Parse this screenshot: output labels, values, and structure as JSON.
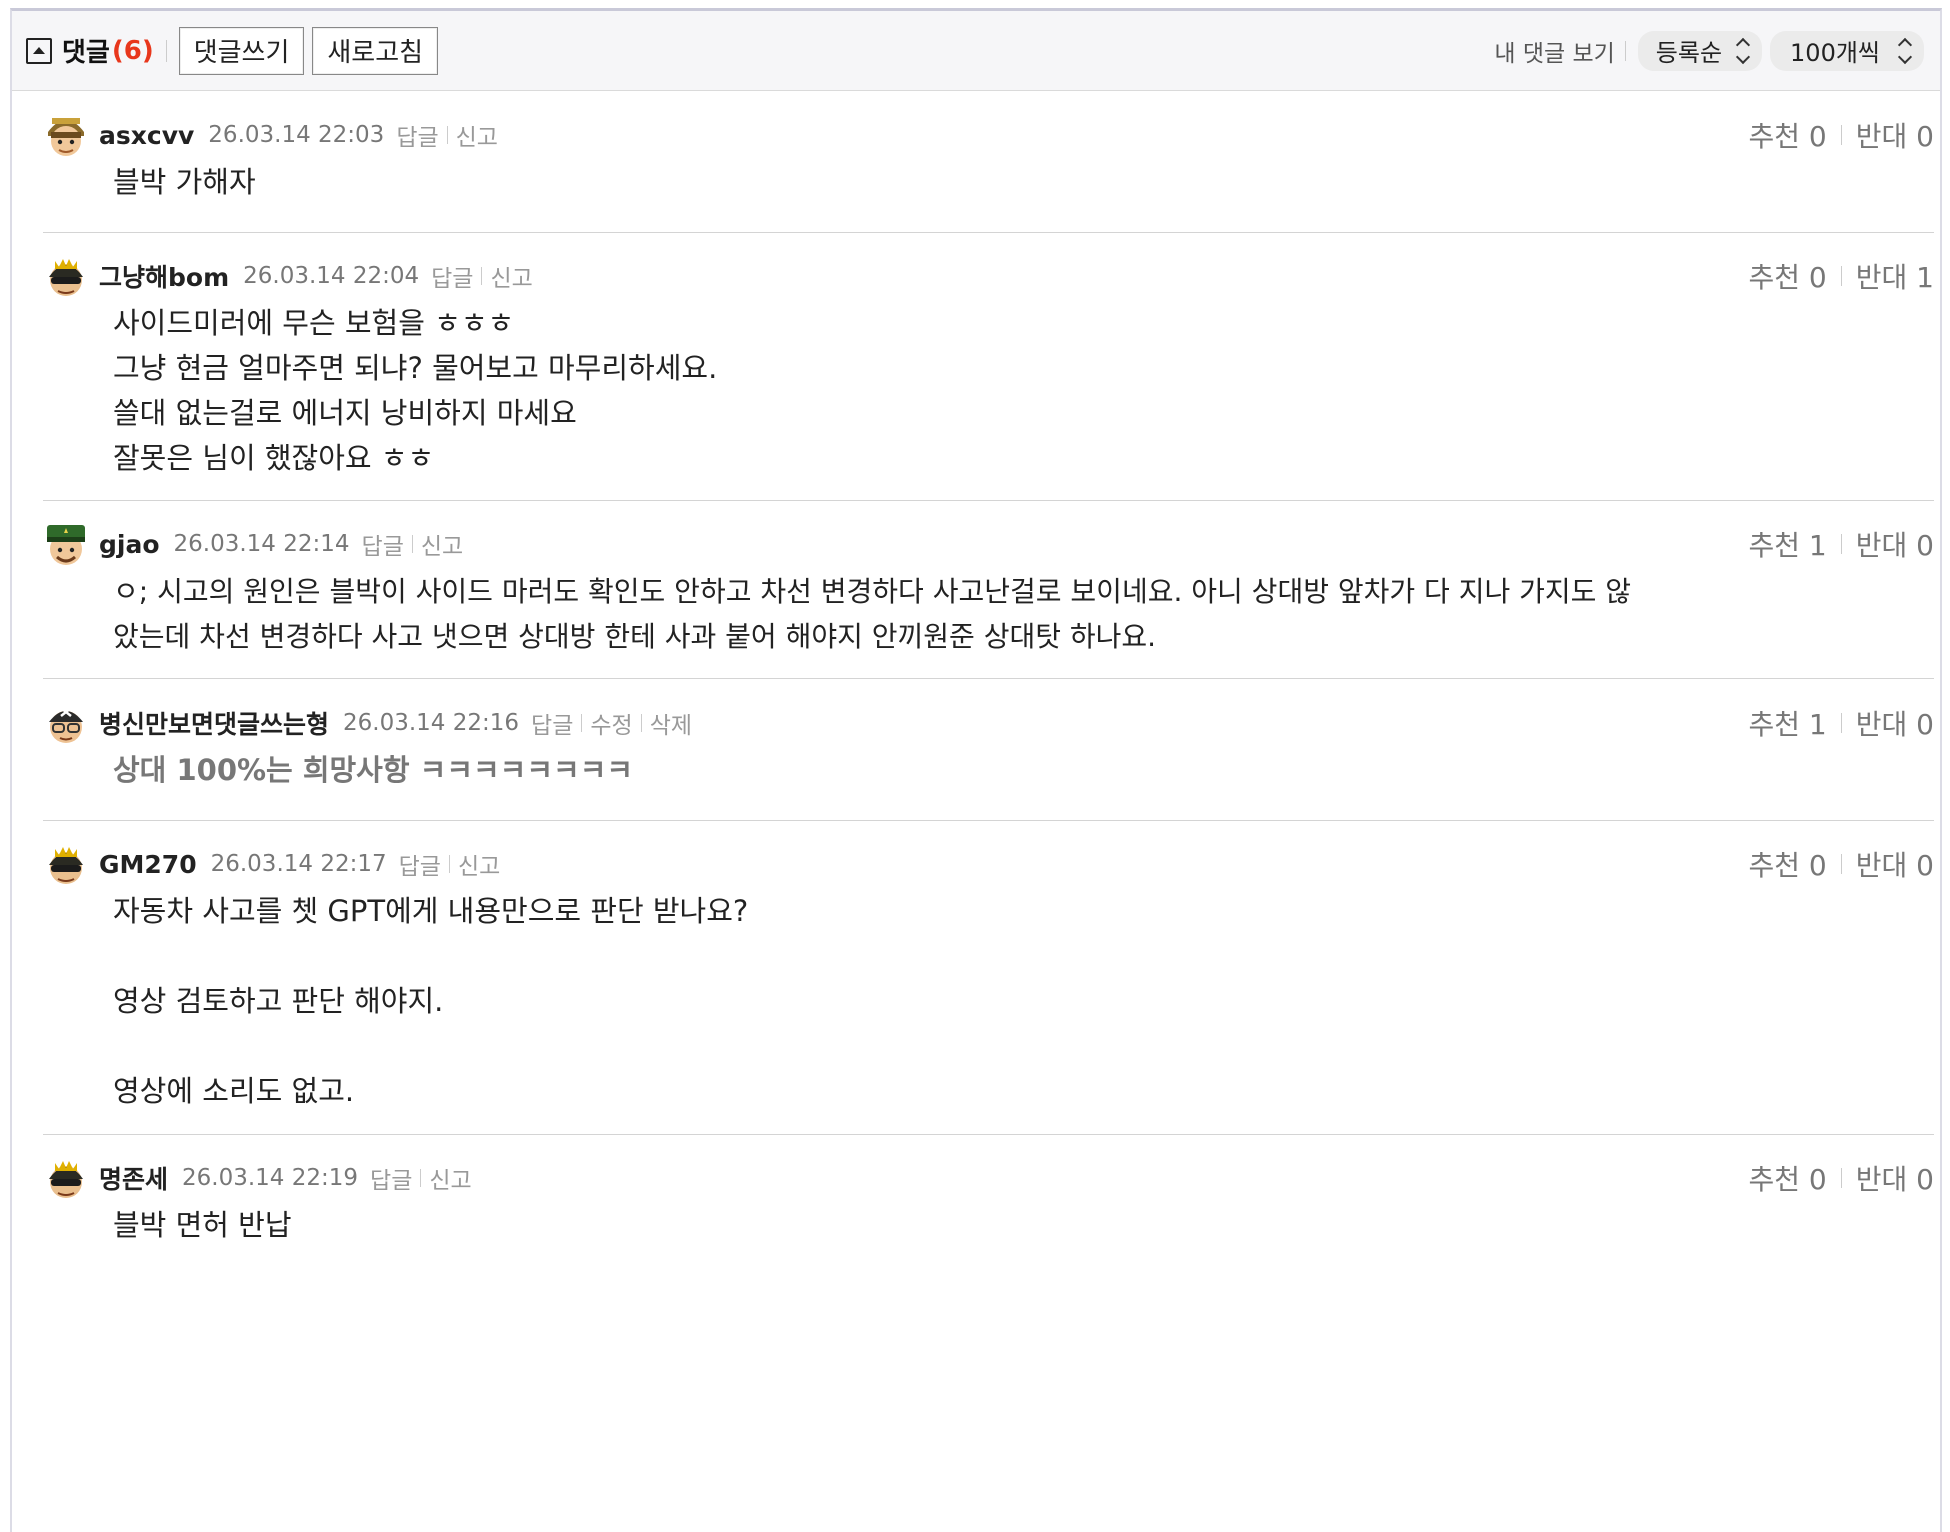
{
  "header": {
    "title": "댓글",
    "count": "(6)",
    "write_label": "댓글쓰기",
    "refresh_label": "새로고침",
    "my_comments_label": "내 댓글 보기",
    "sort_value": "등록순",
    "per_page_value": "100개씩"
  },
  "labels": {
    "recommend": "추천",
    "oppose": "반대"
  },
  "comments": [
    {
      "nick": "asxcvv",
      "date": "26.03.14 22:03",
      "actions": [
        "답글",
        "신고"
      ],
      "up": "0",
      "down": "0",
      "lines": [
        "블박 가해자"
      ]
    },
    {
      "nick": "그냥해bom",
      "date": "26.03.14 22:04",
      "actions": [
        "답글",
        "신고"
      ],
      "up": "0",
      "down": "1",
      "lines": [
        "사이드미러에 무슨 보험을 ㅎㅎㅎ",
        "그냥 현금 얼마주면 되냐? 물어보고 마무리하세요.",
        "쓸대 없는걸로 에너지 낭비하지 마세요",
        "잘못은 님이 했잖아요 ㅎㅎ"
      ]
    },
    {
      "nick": "gjao",
      "date": "26.03.14 22:14",
      "actions": [
        "답글",
        "신고"
      ],
      "up": "1",
      "down": "0",
      "lines": [
        "ㅇ; 시고의 원인은 블박이 사이드 마러도 확인도 안하고 차선 변경하다 사고난걸로 보이네요. 아니 상대방 앞차가 다 지나 가지도 않",
        "았는데 차선 변경하다 사고 냇으면 상대방 한테 사과 붙어 해야지 안끼원준 상대탓 하나요."
      ]
    },
    {
      "nick": "병신만보면댓글쓰는형",
      "date": "26.03.14 22:16",
      "actions": [
        "답글",
        "수정",
        "삭제"
      ],
      "up": "1",
      "down": "0",
      "lines": [
        "상대 100%는 희망사항 ㅋㅋㅋㅋㅋㅋㅋㅋ"
      ]
    },
    {
      "nick": "GM270",
      "date": "26.03.14 22:17",
      "actions": [
        "답글",
        "신고"
      ],
      "up": "0",
      "down": "0",
      "lines": [
        "자동차 사고를 쳇 GPT에게 내용만으로 판단 받나요?",
        "",
        "영상 검토하고 판단 해야지.",
        "",
        "영상에 소리도 없고."
      ]
    },
    {
      "nick": "명존세",
      "date": "26.03.14 22:19",
      "actions": [
        "답글",
        "신고"
      ],
      "up": "0",
      "down": "0",
      "lines": [
        "블박 면허 반납"
      ]
    }
  ]
}
